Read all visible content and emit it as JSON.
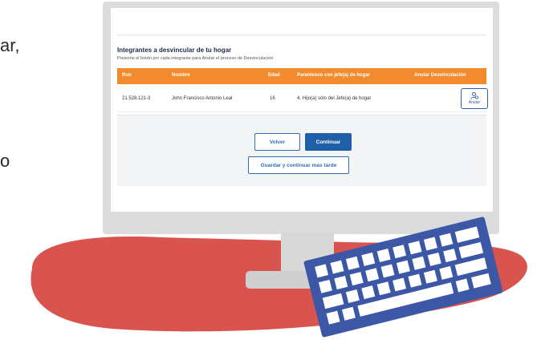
{
  "side_text": [
    "ar,",
    "o"
  ],
  "screen": {
    "title": "Integrantes a desvincular de tu hogar",
    "subtitle": "Presione el botón por cada integrante para Anular el proceso de Desvinculación",
    "table": {
      "headers": [
        "Run",
        "Nombre",
        "Edad",
        "Parentesco con jefe(a) de hogar",
        "Anular Desvinculación"
      ],
      "rows": [
        {
          "run": "21.528.121-3",
          "nombre": "John Francisco Antonio Leal",
          "edad": "16",
          "parentesco": "4. Hijo(a) sólo del Jefe(a) de hogar",
          "action_label": "Anular"
        }
      ]
    },
    "buttons": {
      "volver": "Volver",
      "continuar": "Continuar",
      "guardar": "Guardar y continuar más tarde"
    }
  },
  "colors": {
    "header_orange": "#f28a2e",
    "primary_blue": "#1f5fa8",
    "rug_red": "#d9534f",
    "keyboard_blue": "#3b57a6"
  }
}
